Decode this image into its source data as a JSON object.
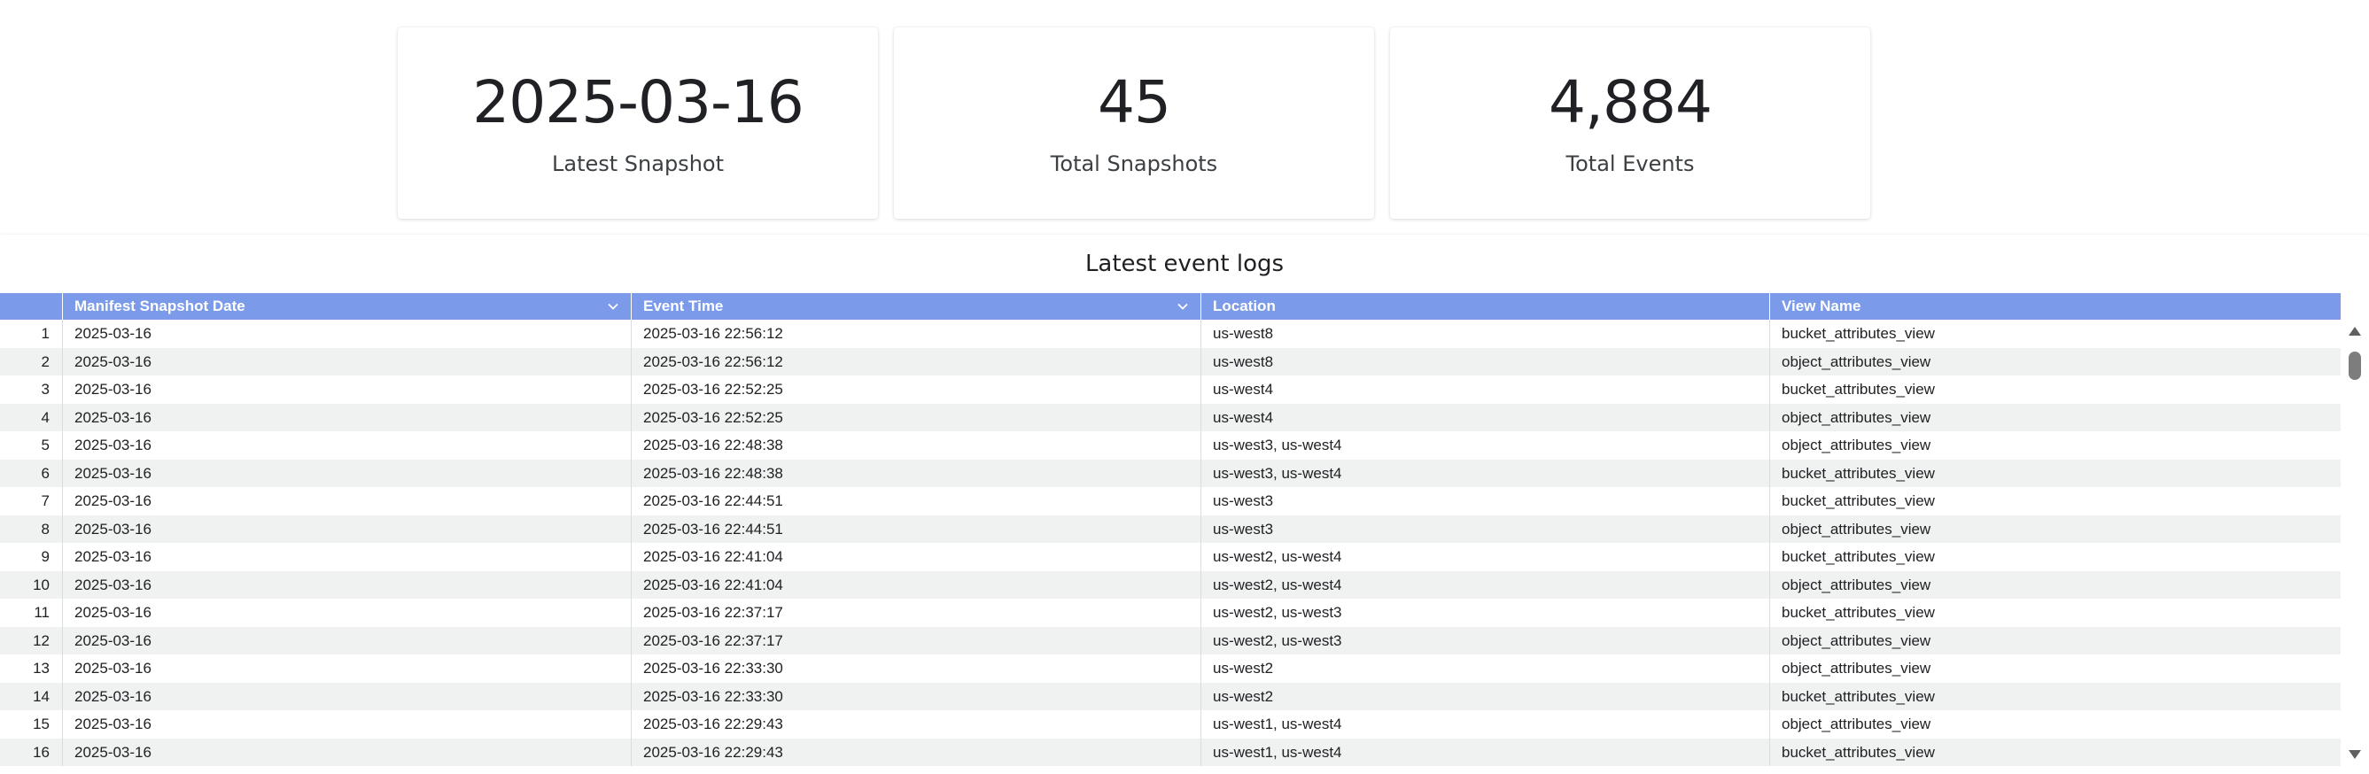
{
  "kpis": [
    {
      "value": "2025-03-16",
      "label": "Latest Snapshot"
    },
    {
      "value": "45",
      "label": "Total Snapshots"
    },
    {
      "value": "4,884",
      "label": "Total Events"
    }
  ],
  "table": {
    "title": "Latest event logs",
    "header_color": "#7b9bea",
    "columns": [
      "Manifest Snapshot Date",
      "Event Time",
      "Location",
      "View Name"
    ],
    "rows": [
      {
        "index": "1",
        "date": "2025-03-16",
        "time": "2025-03-16 22:56:12",
        "location": "us-west8",
        "view": "bucket_attributes_view"
      },
      {
        "index": "2",
        "date": "2025-03-16",
        "time": "2025-03-16 22:56:12",
        "location": "us-west8",
        "view": "object_attributes_view"
      },
      {
        "index": "3",
        "date": "2025-03-16",
        "time": "2025-03-16 22:52:25",
        "location": "us-west4",
        "view": "bucket_attributes_view"
      },
      {
        "index": "4",
        "date": "2025-03-16",
        "time": "2025-03-16 22:52:25",
        "location": "us-west4",
        "view": "object_attributes_view"
      },
      {
        "index": "5",
        "date": "2025-03-16",
        "time": "2025-03-16 22:48:38",
        "location": "us-west3, us-west4",
        "view": "object_attributes_view"
      },
      {
        "index": "6",
        "date": "2025-03-16",
        "time": "2025-03-16 22:48:38",
        "location": "us-west3, us-west4",
        "view": "bucket_attributes_view"
      },
      {
        "index": "7",
        "date": "2025-03-16",
        "time": "2025-03-16 22:44:51",
        "location": "us-west3",
        "view": "bucket_attributes_view"
      },
      {
        "index": "8",
        "date": "2025-03-16",
        "time": "2025-03-16 22:44:51",
        "location": "us-west3",
        "view": "object_attributes_view"
      },
      {
        "index": "9",
        "date": "2025-03-16",
        "time": "2025-03-16 22:41:04",
        "location": "us-west2, us-west4",
        "view": "bucket_attributes_view"
      },
      {
        "index": "10",
        "date": "2025-03-16",
        "time": "2025-03-16 22:41:04",
        "location": "us-west2, us-west4",
        "view": "object_attributes_view"
      },
      {
        "index": "11",
        "date": "2025-03-16",
        "time": "2025-03-16 22:37:17",
        "location": "us-west2, us-west3",
        "view": "bucket_attributes_view"
      },
      {
        "index": "12",
        "date": "2025-03-16",
        "time": "2025-03-16 22:37:17",
        "location": "us-west2, us-west3",
        "view": "object_attributes_view"
      },
      {
        "index": "13",
        "date": "2025-03-16",
        "time": "2025-03-16 22:33:30",
        "location": "us-west2",
        "view": "object_attributes_view"
      },
      {
        "index": "14",
        "date": "2025-03-16",
        "time": "2025-03-16 22:33:30",
        "location": "us-west2",
        "view": "bucket_attributes_view"
      },
      {
        "index": "15",
        "date": "2025-03-16",
        "time": "2025-03-16 22:29:43",
        "location": "us-west1, us-west4",
        "view": "object_attributes_view"
      },
      {
        "index": "16",
        "date": "2025-03-16",
        "time": "2025-03-16 22:29:43",
        "location": "us-west1, us-west4",
        "view": "bucket_attributes_view"
      }
    ]
  }
}
